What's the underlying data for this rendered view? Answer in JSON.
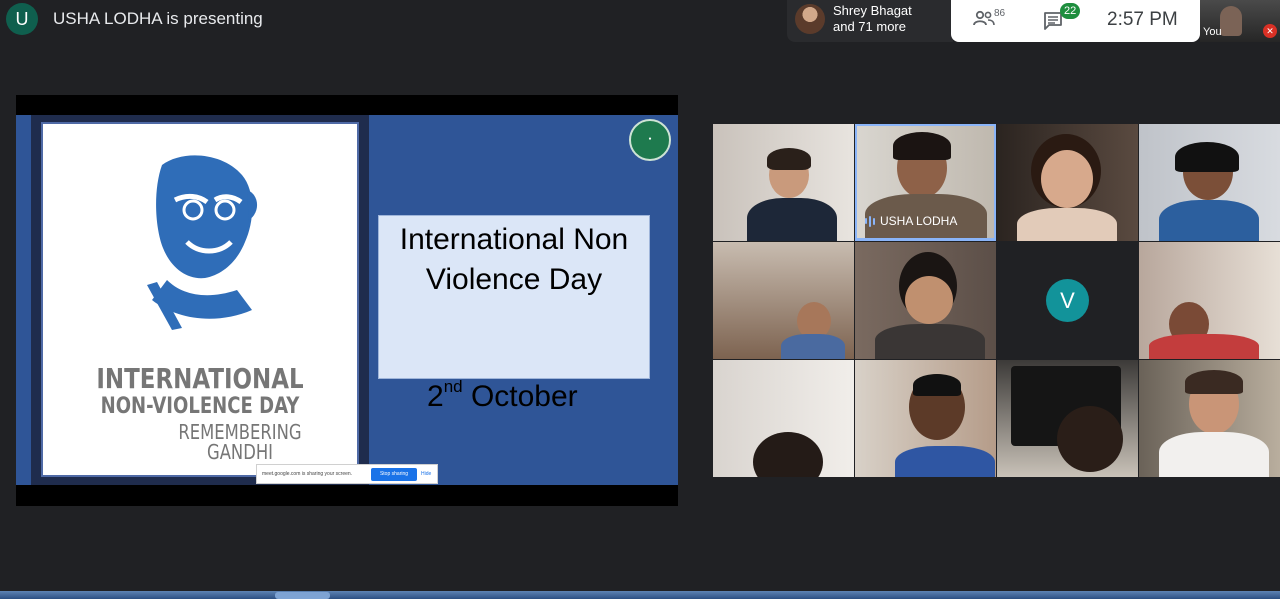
{
  "presenter": {
    "initial": "U",
    "status": "USHA LODHA is presenting"
  },
  "participants_pill": {
    "line1": "Shrey Bhagat",
    "line2": "and 71 more"
  },
  "controls": {
    "people_icon": "people-icon",
    "people_count": "86",
    "chat_icon": "chat-icon",
    "chat_badge": "22",
    "time": "2:57 PM"
  },
  "self_view": {
    "label": "You",
    "mic_icon": "mic-off-icon"
  },
  "slide": {
    "title": "International Non Violence Day",
    "date_day": "2",
    "date_suffix": "nd",
    "date_month": " October",
    "poster_line1": "INTERNATIONAL",
    "poster_line2": "NON-VIOLENCE DAY",
    "poster_line3": "REMEMBERING",
    "poster_line4": "GANDHI",
    "share_message": "meet.google.com is sharing your screen.",
    "stop_sharing": "Stop sharing",
    "hide": "Hide"
  },
  "tiles": {
    "speaker_name": "USHA LODHA",
    "avatar_initial": "V"
  },
  "colors": {
    "accent": "#8ab4f8",
    "presenter_avatar": "#0f5f4e",
    "chat_badge": "#1e8e3e",
    "v_avatar": "#12939a",
    "slide_bg": "#2f5597"
  }
}
